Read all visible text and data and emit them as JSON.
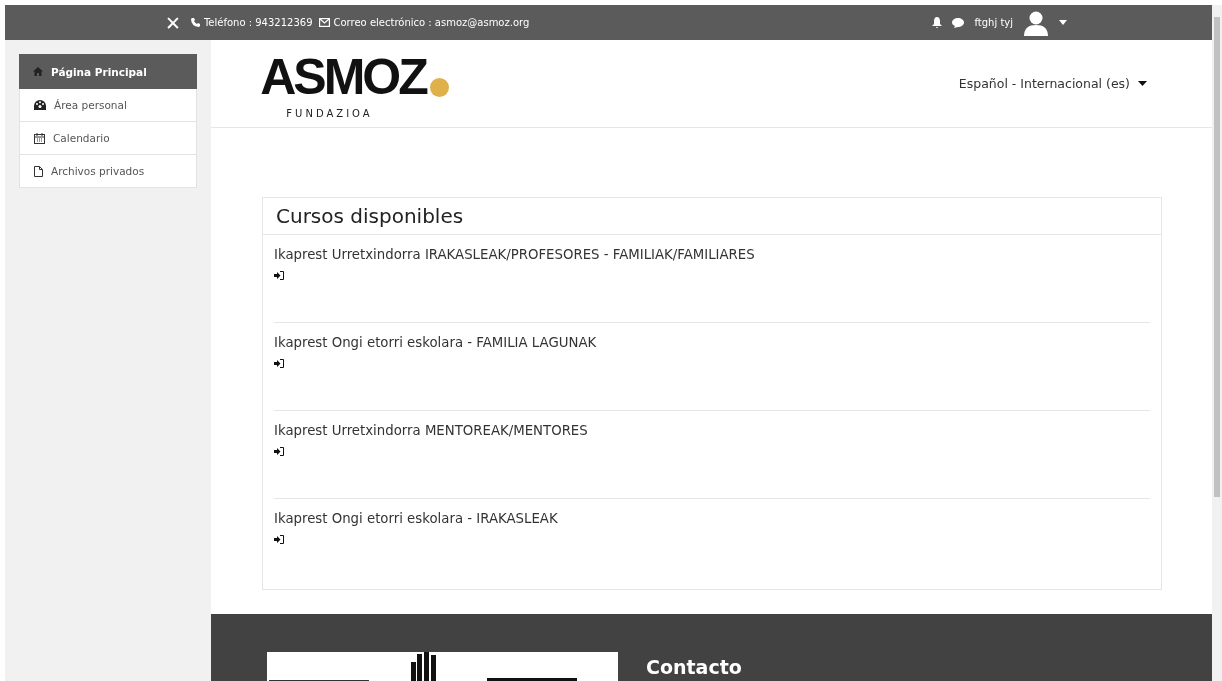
{
  "topbar": {
    "close": "✕",
    "phone": "Teléfono : 943212369",
    "email": "Correo electrónico : asmoz@asmoz.org",
    "user": "ftghj tyj"
  },
  "sidebar": {
    "items": [
      {
        "label": "Página Principal",
        "selected": true
      },
      {
        "label": "Área personal",
        "selected": false
      },
      {
        "label": "Calendario",
        "selected": false
      },
      {
        "label": "Archivos privados",
        "selected": false
      }
    ]
  },
  "header": {
    "logo": "ASMOZ",
    "logo_subtitle": "FUNDAZIOA",
    "language": "Español - Internacional (es)"
  },
  "courses": {
    "title": "Cursos disponibles",
    "items": [
      {
        "name": "Ikaprest Urretxindorra IRAKASLEAK/PROFESORES - FAMILIAK/FAMILIARES"
      },
      {
        "name": "Ikaprest Ongi etorri eskolara - FAMILIA LAGUNAK"
      },
      {
        "name": "Ikaprest Urretxindorra MENTOREAK/MENTORES"
      },
      {
        "name": "Ikaprest Ongi etorri eskolara - IRAKASLEAK"
      }
    ]
  },
  "footer": {
    "heading": "Contacto"
  }
}
